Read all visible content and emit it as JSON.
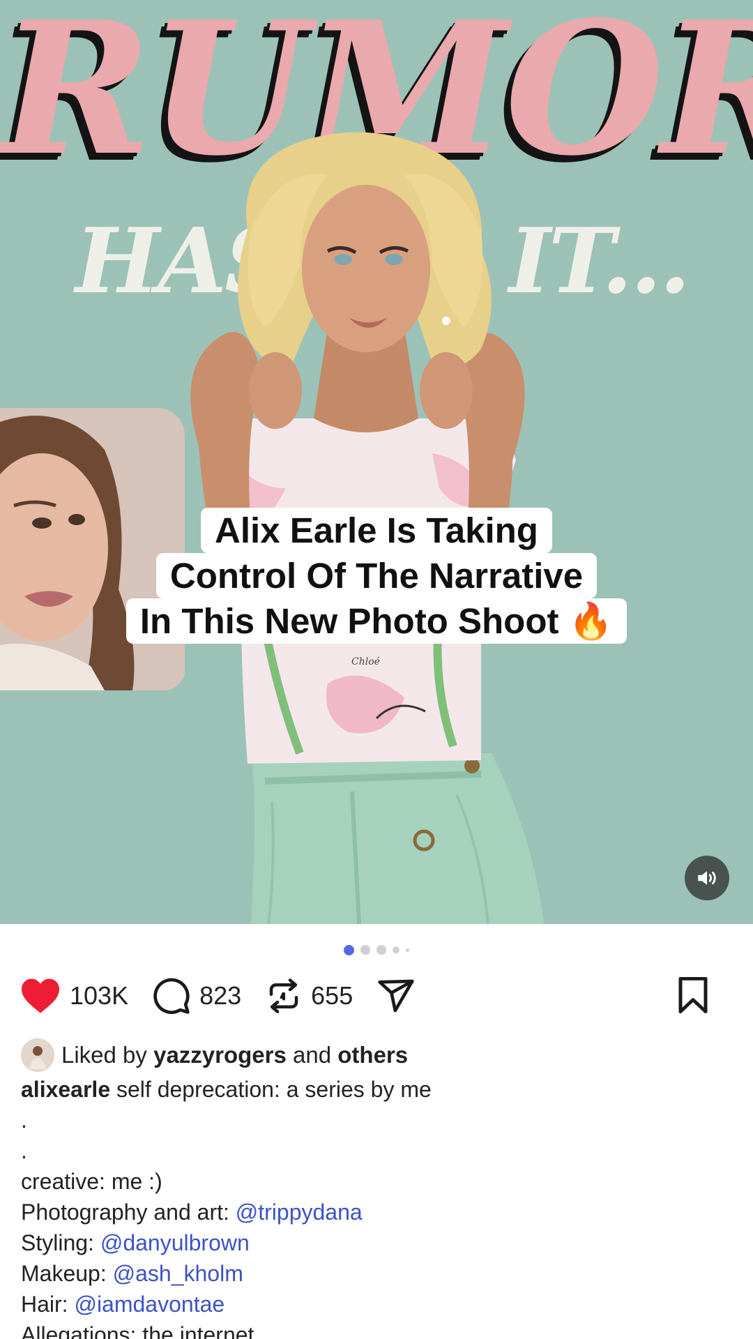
{
  "post_image": {
    "title_word": "RUMOR",
    "has_word": "HAS",
    "it_word": "IT...",
    "overlay_caption": [
      "Alix Earle Is Taking",
      "Control Of The Narrative",
      "In This New Photo Shoot 🔥"
    ],
    "shirt_text": "Chloé"
  },
  "carousel": {
    "count": 5,
    "active_index": 0,
    "active_color": "#5368e9"
  },
  "actions": {
    "likes": "103K",
    "comments": "823",
    "reposts": "655",
    "like_color": "#ee1d36"
  },
  "liked_by": {
    "prefix": "Liked by",
    "user": "yazzyrogers",
    "and": "and",
    "others": "others"
  },
  "caption": {
    "username": "alixearle",
    "text": "self deprecation: a series by me",
    "dot1": ".",
    "dot2": ".",
    "creative": "creative: me :)",
    "photography_label": "Photography and art:",
    "photography_handle": "@trippydana",
    "styling_label": "Styling:",
    "styling_handle": "@danyulbrown",
    "makeup_label": "Makeup:",
    "makeup_handle": "@ash_kholm",
    "hair_label": "Hair:",
    "hair_handle": "@iamdavontae",
    "allegations": "Allegations: the internet"
  },
  "icons": [
    "heart-icon",
    "comment-icon",
    "repost-icon",
    "share-icon",
    "bookmark-icon",
    "speaker-icon"
  ]
}
